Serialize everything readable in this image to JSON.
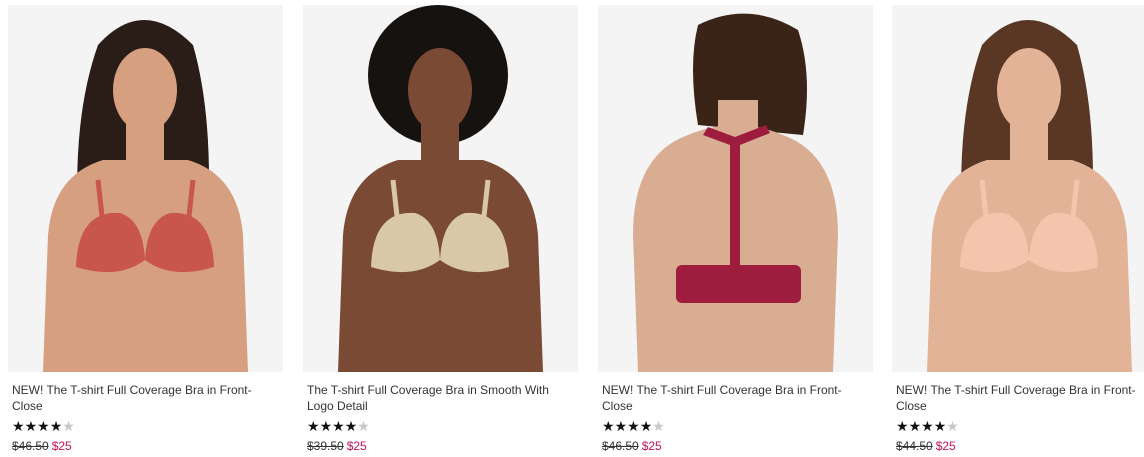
{
  "products": [
    {
      "title": "NEW! The T-shirt Full Coverage Bra in Front-Close",
      "rating_stars": 4,
      "original_price": "$46.50",
      "sale_price": "$25",
      "skin": "#d6a080",
      "hair": "#2a1c16",
      "garment": "#c8564a",
      "view": "front"
    },
    {
      "title": "The T-shirt Full Coverage Bra in Smooth With Logo Detail",
      "rating_stars": 4,
      "original_price": "$39.50",
      "sale_price": "$25",
      "skin": "#7a4a34",
      "hair": "#161210",
      "garment": "#d8c8a8",
      "view": "front"
    },
    {
      "title": "NEW! The T-shirt Full Coverage Bra in Front-Close",
      "rating_stars": 4,
      "original_price": "$46.50",
      "sale_price": "$25",
      "skin": "#d9ad92",
      "hair": "#3a2418",
      "garment": "#9e1c3e",
      "view": "back"
    },
    {
      "title": "NEW! The T-shirt Full Coverage Bra in Front-Close",
      "rating_stars": 4,
      "original_price": "$44.50",
      "sale_price": "$25",
      "skin": "#e3b398",
      "hair": "#5a3624",
      "garment": "#f6c4ac",
      "view": "front"
    }
  ],
  "colors": {
    "sale_price": "#c4105a",
    "star_filled": "#111111",
    "star_empty": "#c8c8c8",
    "photo_background": "#f4f4f4"
  }
}
